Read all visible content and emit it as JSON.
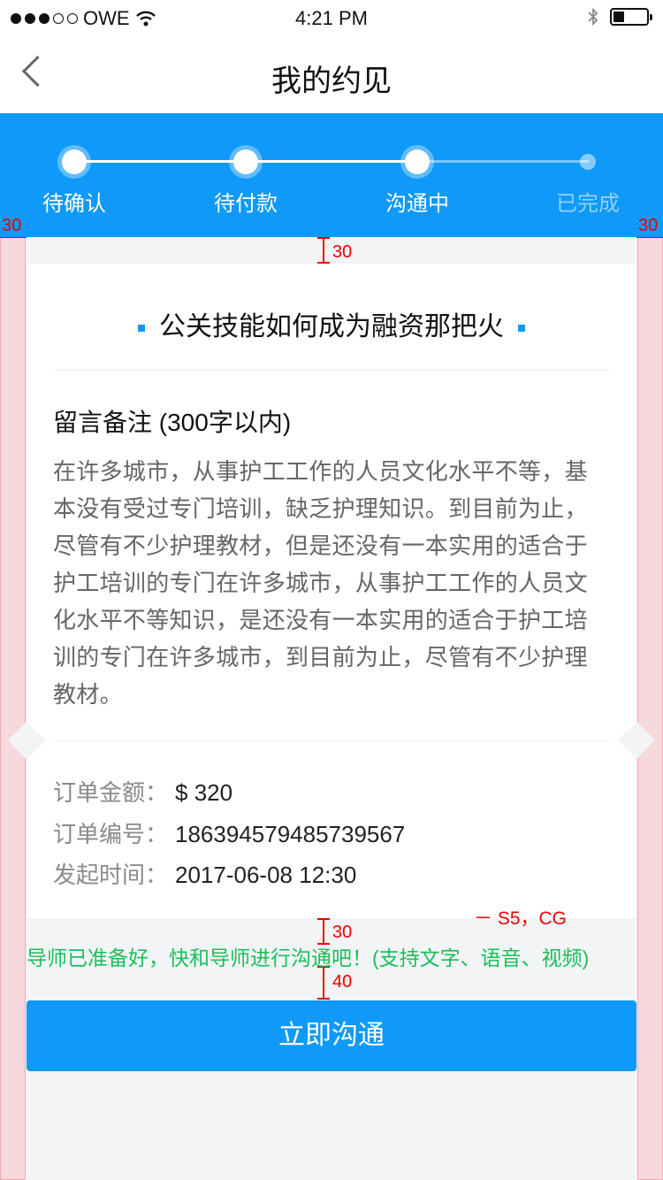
{
  "status_bar": {
    "carrier": "OWE",
    "time": "4:21 PM"
  },
  "nav": {
    "title": "我的约见"
  },
  "progress": {
    "steps": [
      {
        "label": "待确认"
      },
      {
        "label": "待付款"
      },
      {
        "label": "沟通中"
      },
      {
        "label": "已完成"
      }
    ]
  },
  "card": {
    "topic": "公关技能如何成为融资那把火",
    "note_heading": "留言备注 (300字以内)",
    "note_body": "在许多城市，从事护工工作的人员文化水平不等，基本没有受过专门培训，缺乏护理知识。到目前为止，尽管有不少护理教材，但是还没有一本实用的适合于护工培训的专门在许多城市，从事护工工作的人员文化水平不等知识，是还没有一本实用的适合于护工培训的专门在许多城市，到目前为止，尽管有不少护理教材。",
    "order_amount_label": "订单金额：",
    "order_amount": "$ 320",
    "order_no_label": "订单编号：",
    "order_no": "186394579485739567",
    "start_time_label": "发起时间：",
    "start_time": "2017-06-08  12:30"
  },
  "hint": "导师已准备好，快和导师进行沟通吧！(支持文字、语音、视频)",
  "action_button": "立即沟通",
  "annotations": {
    "margin_left": "30",
    "margin_right": "30",
    "card_top_gap": "30",
    "hint_top_gap": "30",
    "hint_bottom_gap": "40",
    "hint_spec": "－ S5，CG"
  },
  "colors": {
    "primary": "#0f99f8",
    "hint_green": "#18c05a",
    "annotation_red": "#e00000"
  }
}
